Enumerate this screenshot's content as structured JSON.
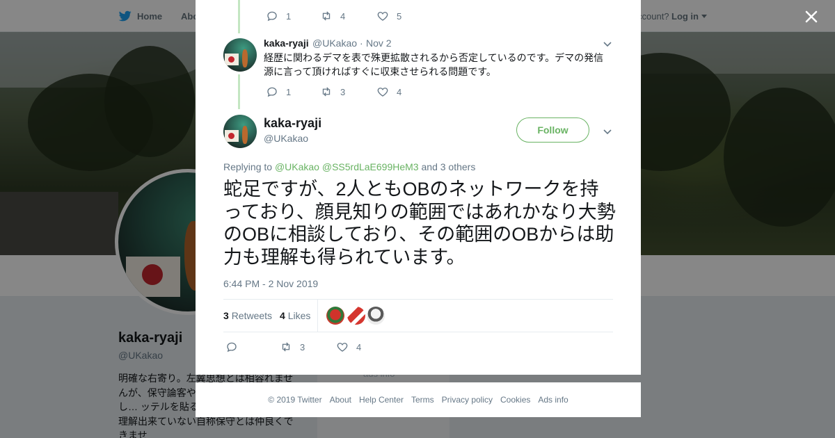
{
  "topnav": {
    "home_label": "Home",
    "about_label": "Abo",
    "account_prompt": "ccount?",
    "login_label": "Log in"
  },
  "background_profile": {
    "name": "kaka-ryaji",
    "handle": "@UKakao",
    "bio": "明確な右寄り。左翼思想とは相容れませんが、保守論客や… トに意見、指摘し… ッテルを貼る「保守」の意味すら理解出来ていない自称保守とは仲良くできませ",
    "center_text": "ads info"
  },
  "thread": {
    "prev_tweet_actions": {
      "replies": "1",
      "retweets": "4",
      "likes": "5"
    },
    "reply_tweet": {
      "name": "kaka-ryaji",
      "handle": "@UKakao",
      "sep": "·",
      "date": "Nov 2",
      "text": "経歴に関わるデマを表で殊更拡散されるから否定しているのです。デマの発信源に言って頂ければすぐに収束させられる問題です。",
      "actions": {
        "replies": "1",
        "retweets": "3",
        "likes": "4"
      }
    },
    "main_tweet": {
      "name": "kaka-ryaji",
      "handle": "@UKakao",
      "follow_label": "Follow",
      "replying_prefix": "Replying to",
      "mention_1": "@UKakao",
      "mention_2": "@SS5rdLaE699HeM3",
      "replying_suffix": "and 3 others",
      "text": "蛇足ですが、2人ともOBのネットワークを持っており、顔見知りの範囲ではあれかなり大勢のOBに相談しており、その範囲のOBからは助力も理解も得られています。",
      "timestamp": "6:44 PM - 2 Nov 2019",
      "retweets_count": "3",
      "retweets_label": "Retweets",
      "likes_count": "4",
      "likes_label": "Likes",
      "actions": {
        "retweets": "3",
        "likes": "4"
      }
    }
  },
  "footer": {
    "links": [
      "© 2019 Twitter",
      "About",
      "Help Center",
      "Terms",
      "Privacy policy",
      "Cookies",
      "Ads info"
    ]
  },
  "colors": {
    "accent_green": "#69b363",
    "thread_line": "#c4e6c2",
    "muted_text": "#657786"
  },
  "icons": [
    "twitter-bird-icon",
    "close-icon",
    "reply-icon",
    "retweet-icon",
    "like-icon",
    "chevron-down-icon"
  ]
}
